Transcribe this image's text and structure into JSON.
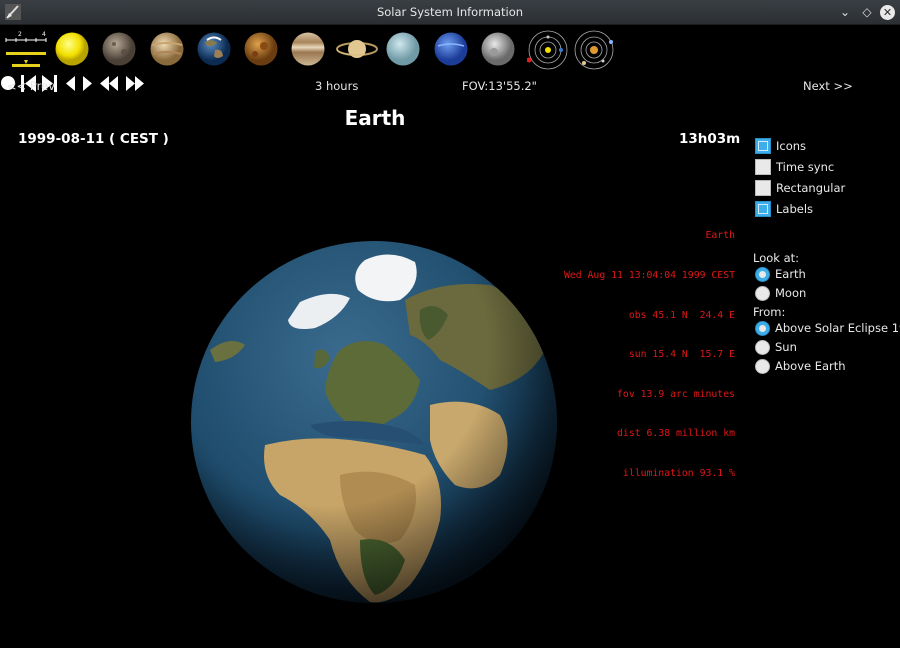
{
  "window": {
    "title": "Solar System Information"
  },
  "toolbar": {
    "planets": [
      "Sun",
      "Mercury",
      "Venus",
      "Earth",
      "Mars",
      "Jupiter",
      "Saturn",
      "Uranus",
      "Neptune",
      "Pluto"
    ],
    "scale_ticks": [
      "2",
      "4"
    ]
  },
  "controls": {
    "prev_label": "<<  Prev",
    "next_label": "Next  >>",
    "step_label": "3 hours",
    "fov_label": "FOV:13'55.2\""
  },
  "view": {
    "heading": "Earth",
    "date": "1999-08-11   ( CEST )",
    "time": "13h03m"
  },
  "info_lines": [
    "Earth",
    "Wed Aug 11 13:04:04 1999 CEST",
    "obs 45.1 N  24.4 E",
    "sun 15.4 N  15.7 E",
    "fov 13.9 arc minutes",
    "dist 6.38 million km",
    "illumination 93.1 %"
  ],
  "options": [
    {
      "label": "Icons",
      "checked": true
    },
    {
      "label": "Time sync",
      "checked": false
    },
    {
      "label": "Rectangular",
      "checked": false
    },
    {
      "label": "Labels",
      "checked": true
    }
  ],
  "look_at": {
    "label": "Look at:",
    "items": [
      {
        "label": "Earth",
        "selected": true
      },
      {
        "label": "Moon",
        "selected": false
      }
    ]
  },
  "from": {
    "label": "From:",
    "items": [
      {
        "label": "Above Solar Eclipse 1999",
        "selected": true
      },
      {
        "label": "Sun",
        "selected": false
      },
      {
        "label": "Above Earth",
        "selected": false
      }
    ]
  },
  "colors": {
    "accent": "#3daee9",
    "info_text": "#e01818"
  }
}
